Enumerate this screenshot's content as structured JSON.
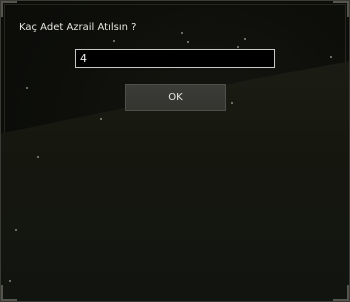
{
  "dialog": {
    "prompt": "Kaç Adet Azrail Atılsın ?",
    "input_value": "4",
    "ok_label": "OK"
  }
}
